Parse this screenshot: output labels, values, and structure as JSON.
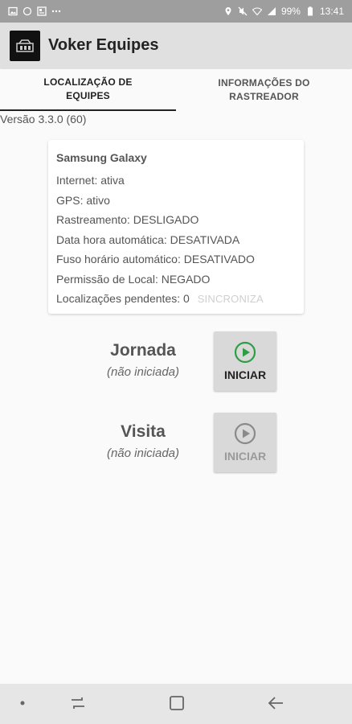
{
  "status_bar": {
    "battery": "99%",
    "time": "13:41",
    "left_icons": [
      "image-icon",
      "circle-icon",
      "news-icon",
      "more-icon"
    ],
    "right_icons": [
      "location-icon",
      "mute-icon",
      "wifi-icon",
      "signal-icon",
      "battery-icon"
    ]
  },
  "app_bar": {
    "title": "Voker Equipes",
    "logo_icon": "voker-logo-icon"
  },
  "tabs": [
    {
      "label": "LOCALIZAÇÃO DE EQUIPES",
      "active": true
    },
    {
      "label": "INFORMAÇÕES DO RASTREADOR",
      "active": false
    }
  ],
  "version": "Versão 3.3.0 (60)",
  "device_card": {
    "title": "Samsung Galaxy",
    "lines": [
      "Internet: ativa",
      "GPS: ativo",
      "Rastreamento: DESLIGADO",
      "Data hora automática: DESATIVADA",
      "Fuso horário automático: DESATIVADO",
      "Permissão de Local: NEGADO"
    ],
    "pending_label": "Localizações pendentes: 0",
    "sync_button": "SINCRONIZA"
  },
  "jornada": {
    "name": "Jornada",
    "status": "(não iniciada)",
    "button_label": "INICIAR",
    "enabled": true,
    "icon_color": "#2e9e44"
  },
  "visita": {
    "name": "Visita",
    "status": "(não iniciada)",
    "button_label": "INICIAR",
    "enabled": false,
    "icon_color": "#8a8a8a"
  },
  "nav_bar": {
    "items": [
      "dot-icon",
      "recent-apps-icon",
      "home-icon",
      "back-icon"
    ]
  },
  "colors": {
    "app_bar": "#e0e0e0",
    "status_bar": "#9e9e9e",
    "button_bg": "#d9d9d9",
    "play_enabled": "#2e9e44"
  }
}
